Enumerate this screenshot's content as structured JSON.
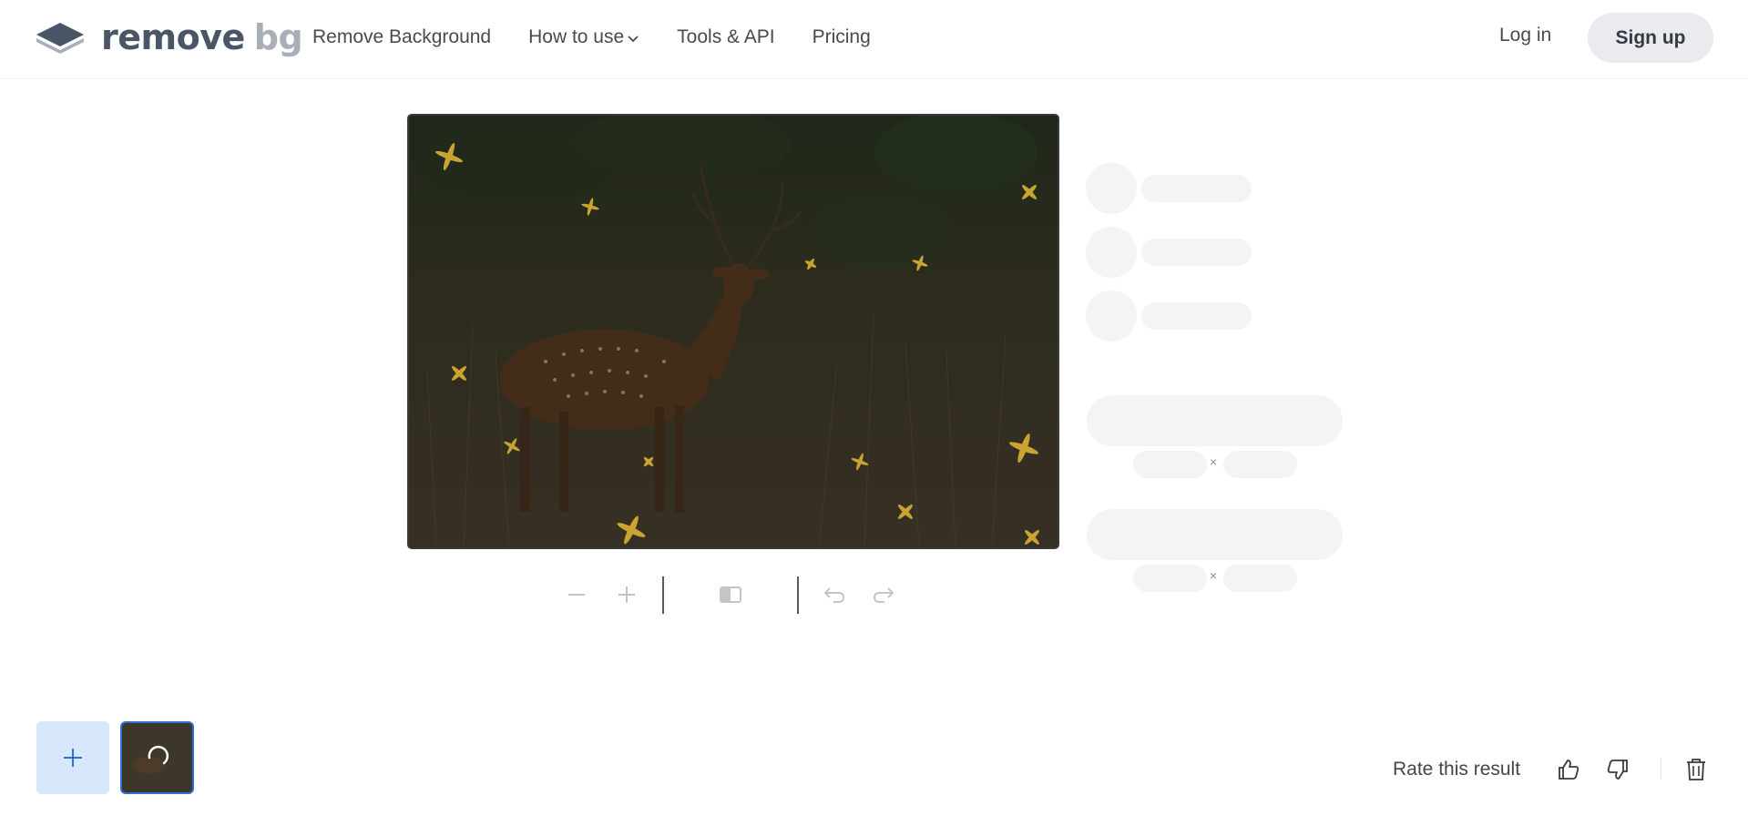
{
  "header": {
    "logo": {
      "word1": "remove",
      "word2": "bg",
      "icon": "layers-logo-icon"
    },
    "nav": [
      {
        "label": "Remove Background"
      },
      {
        "label": "How to use",
        "icon": "chevron-down-icon"
      },
      {
        "label": "Tools & API"
      },
      {
        "label": "Pricing"
      }
    ],
    "login_label": "Log in",
    "signup_label": "Sign up"
  },
  "editor": {
    "image_subject": "spotted deer (chital) standing in grassland, darkened with sparkle processing overlay",
    "toolbar": {
      "zoom_out": "minus-icon",
      "zoom_in": "plus-icon",
      "compare": "compare-icon",
      "undo": "undo-icon",
      "redo": "redo-icon"
    },
    "sidebar_skeleton": {
      "rows": 3,
      "size_separator_1": "×",
      "size_separator_2": "×"
    }
  },
  "bottom": {
    "add_icon": "plus-icon",
    "rate_label": "Rate this result",
    "thumbs_up": "thumbs-up-icon",
    "thumbs_down": "thumbs-down-icon",
    "delete": "trash-icon"
  },
  "colors": {
    "accent_blue": "#2f6fd6",
    "add_button_bg": "#d8e6fc",
    "skeleton": "#f3f4f6",
    "sparkle": "#c9a431"
  }
}
